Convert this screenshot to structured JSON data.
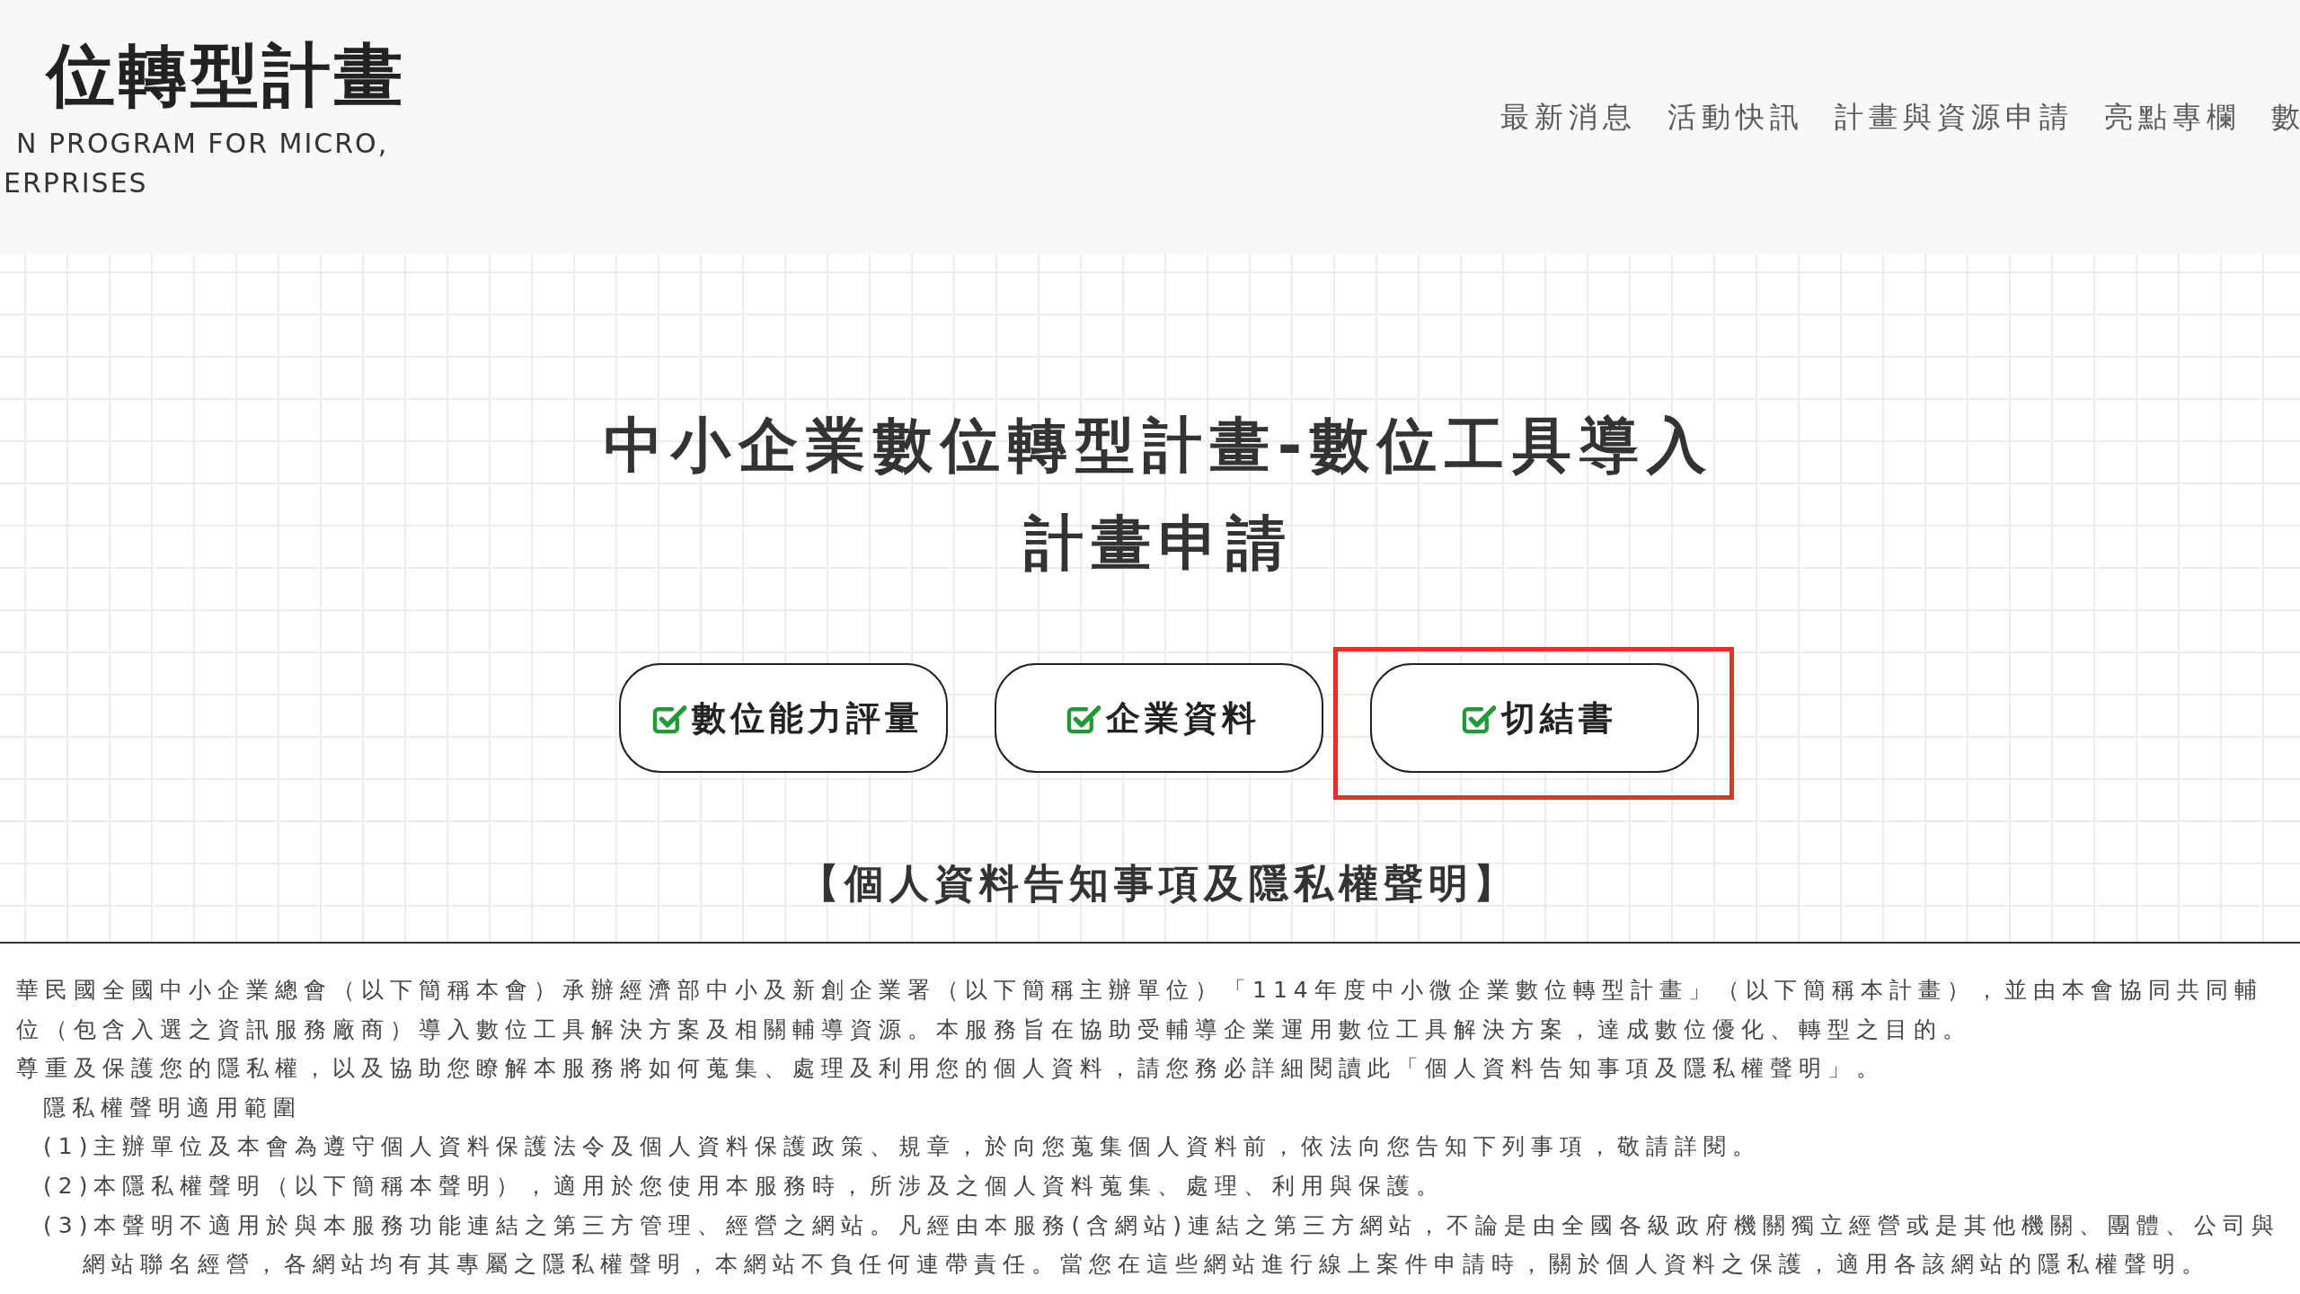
{
  "header": {
    "logo": {
      "title": "位轉型計畫",
      "subtitle_lines": [
        "N PROGRAM FOR MICRO,",
        "ERPRISES"
      ]
    },
    "nav": [
      {
        "label": "最新消息"
      },
      {
        "label": "活動快訊"
      },
      {
        "label": "計畫與資源申請"
      },
      {
        "label": "亮點專欄"
      },
      {
        "label": "數"
      }
    ]
  },
  "main": {
    "title": "中小企業數位轉型計畫-數位工具導入計畫申請",
    "steps": [
      {
        "label": "數位能力評量",
        "checked": true,
        "highlighted": false
      },
      {
        "label": "企業資料",
        "checked": true,
        "highlighted": false
      },
      {
        "label": "切結書",
        "checked": true,
        "highlighted": true
      }
    ],
    "notice_heading": "【個人資料告知事項及隱私權聲明】"
  },
  "notice": {
    "paragraphs": [
      {
        "lines": [
          "華民國全國中小企業總會（以下簡稱本會）承辦經濟部中小及新創企業署（以下簡稱主辦單位）「114年度中小微企業數位轉型計畫」（以下簡稱本計畫），並由本會協同共同輔",
          "位（包含入選之資訊服務廠商）導入數位工具解決方案及相關輔導資源。本服務旨在協助受輔導企業運用數位工具解決方案，達成數位優化、轉型之目的。"
        ]
      },
      {
        "lines": [
          "尊重及保護您的隱私權，以及協助您瞭解本服務將如何蒐集、處理及利用您的個人資料，請您務必詳細閱讀此「個人資料告知事項及隱私權聲明」。"
        ]
      }
    ],
    "sections": [
      {
        "title": "隱私權聲明適用範圍",
        "items": [
          {
            "lines": [
              "(1)主辦單位及本會為遵守個人資料保護法令及個人資料保護政策、規章，於向您蒐集個人資料前，依法向您告知下列事項，敬請詳閱。"
            ]
          },
          {
            "lines": [
              "(2)本隱私權聲明（以下簡稱本聲明），適用於您使用本服務時，所涉及之個人資料蒐集、處理、利用與保護。"
            ]
          },
          {
            "lines": [
              "(3)本聲明不適用於與本服務功能連結之第三方管理、經營之網站。凡經由本服務(含網站)連結之第三方網站，不論是由全國各級政府機關獨立經營或是其他機關、團體、公司與",
              "網站聯名經營，各網站均有其專屬之隱私權聲明，本網站不負任何連帶責任。當您在這些網站進行線上案件申請時，關於個人資料之保護，適用各該網站的隱私權聲明。"
            ]
          }
        ]
      }
    ]
  }
}
